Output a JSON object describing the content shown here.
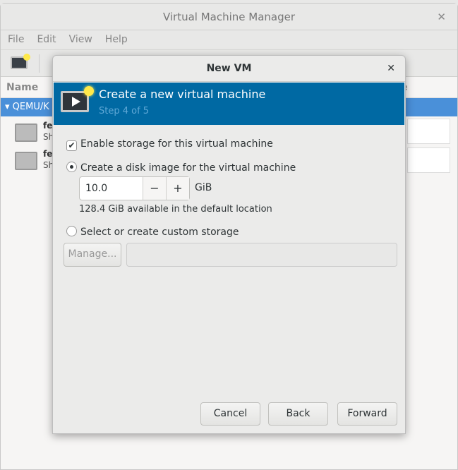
{
  "main": {
    "title": "Virtual Machine Manager",
    "menu": [
      "File",
      "Edit",
      "View",
      "Help"
    ],
    "column_name": "Name",
    "column_right": "e",
    "group": "QEMU/K",
    "vms": [
      {
        "name": "fe",
        "status": "Sh"
      },
      {
        "name": "fe",
        "status": "Sh"
      }
    ]
  },
  "dialog": {
    "title": "New VM",
    "header": "Create a new virtual machine",
    "step": "Step 4 of 5",
    "enable_storage": "Enable storage for this virtual machine",
    "create_disk": "Create a disk image for the virtual machine",
    "size": "10.0",
    "minus": "−",
    "plus": "+",
    "unit": "GiB",
    "available": "128.4 GiB available in the default location",
    "custom": "Select or create custom storage",
    "manage": "Manage...",
    "custom_path": "",
    "cancel": "Cancel",
    "back": "Back",
    "forward": "Forward"
  },
  "colors": {
    "banner": "#0069a3",
    "selection": "#4a90d9"
  }
}
